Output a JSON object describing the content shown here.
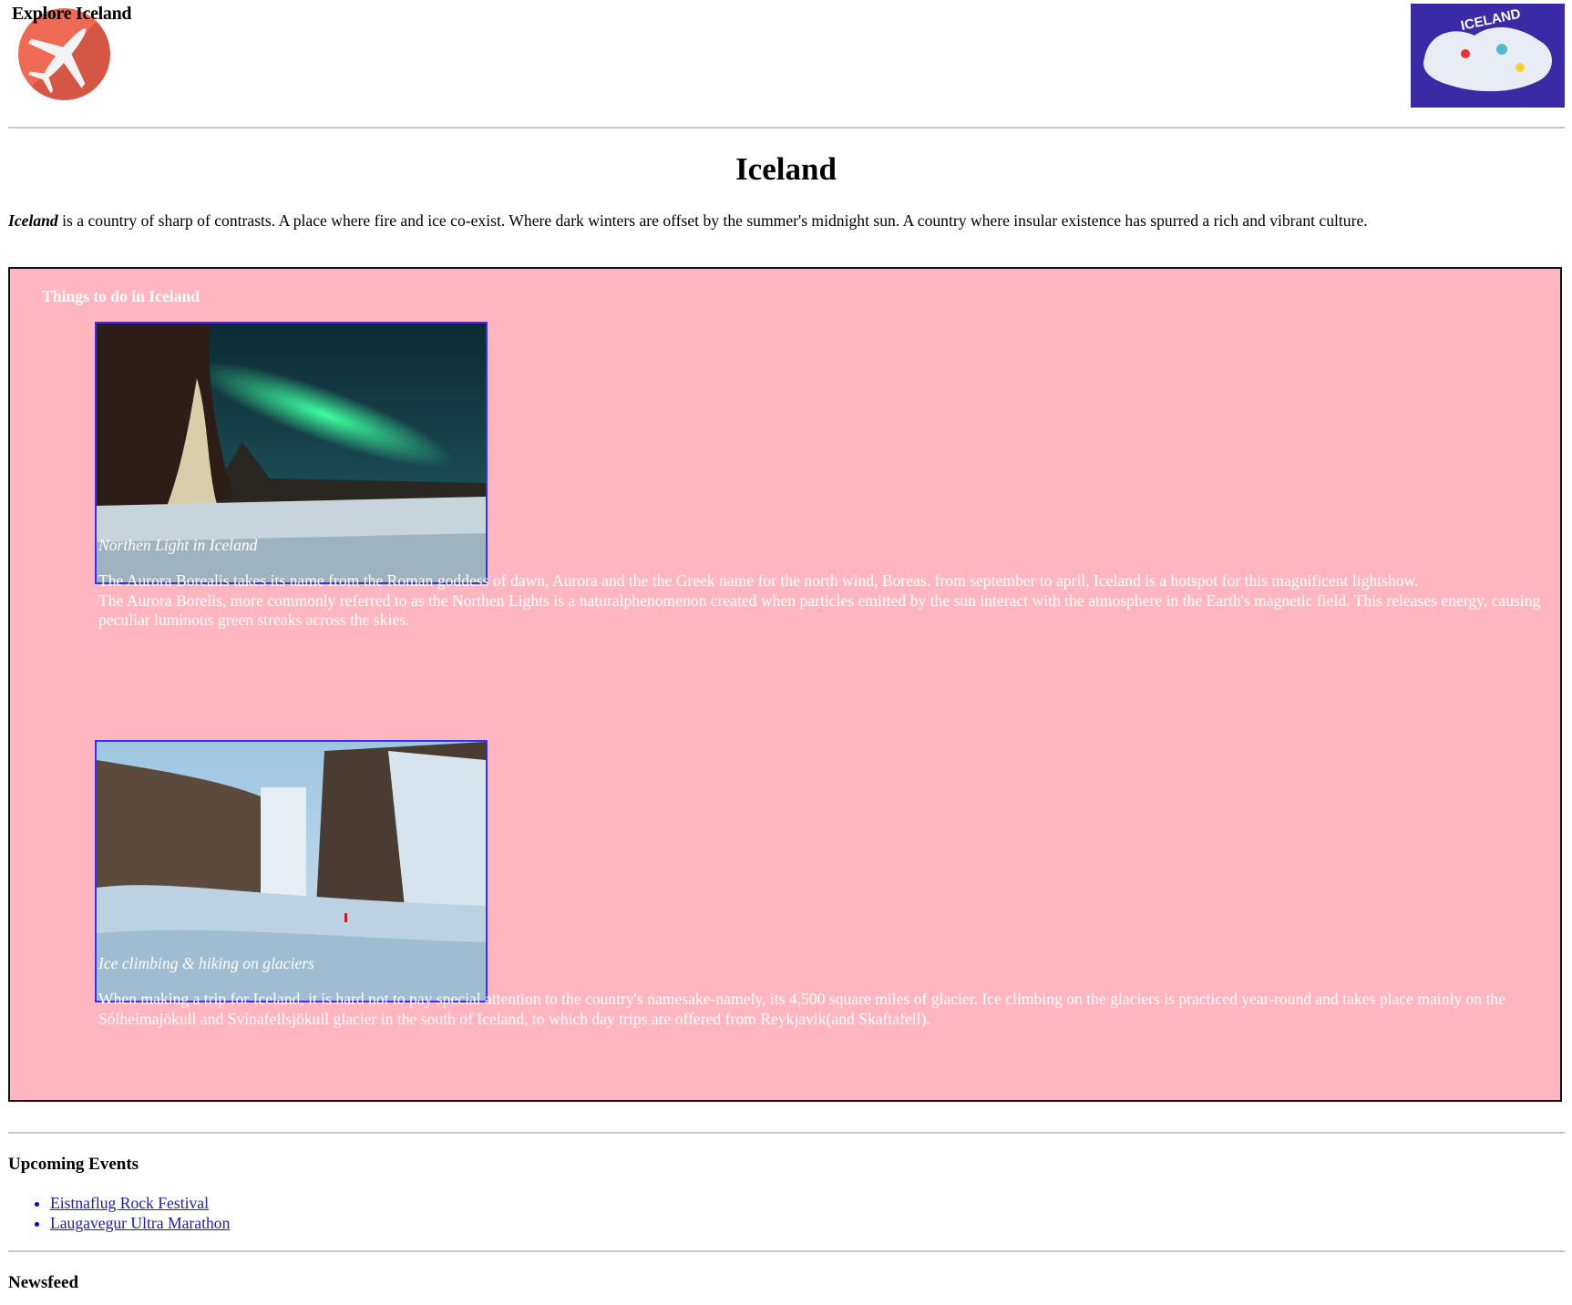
{
  "header": {
    "site_title": "Explore Iceland",
    "logo_icon": "airplane-icon",
    "map_image_alt": "ICELAND"
  },
  "main": {
    "title": "Iceland",
    "intro_emphasis": "Iceland",
    "intro_text": " is a country of sharp of contrasts. A place where fire and ice co-exist. Where dark winters are offset by the summer's midnight sun. A country where insular existence has spurred a rich and vibrant culture."
  },
  "things_to_do": {
    "heading": "Things to do in Iceland",
    "background_color": "#ffb6c1",
    "items": [
      {
        "caption": "Northen Light in Iceland",
        "lines": [
          "The Aurora Borealis takes its name from the Roman goddess of dawn, Aurora and the the Greek name for the north wind, Boreas. from september to april, Iceland is a hotspot for this magnificent lightshow.",
          "The Aurora Borelis, more commonly referred to as the Northen Lights is a naturalphenomenon created when particles emitted by the sun interact with the atmosphere in the Earth's magnetic field. This releases energy, causing peculiar luminous green streaks across the skies."
        ]
      },
      {
        "caption": "Ice climbing & hiking on glaciers",
        "lines": [
          "When making a trip for Iceland, it is hard not to pay special attention to the country's namesake-namely, its 4,500 square miles of glacier. Ice climbing on the glaciers is practiced year-round and takes place mainly on the Sólheimajökull and Svínafellsjökull glacier in the south of Iceland, to which day trips are offered from Reykjavik(and Skaftafell)."
        ]
      }
    ]
  },
  "events": {
    "heading": "Upcoming Events",
    "items": [
      "Eistnaflug Rock Festival",
      "Laugavegur Ultra Marathon"
    ]
  },
  "newsfeed": {
    "heading": "Newsfeed"
  }
}
